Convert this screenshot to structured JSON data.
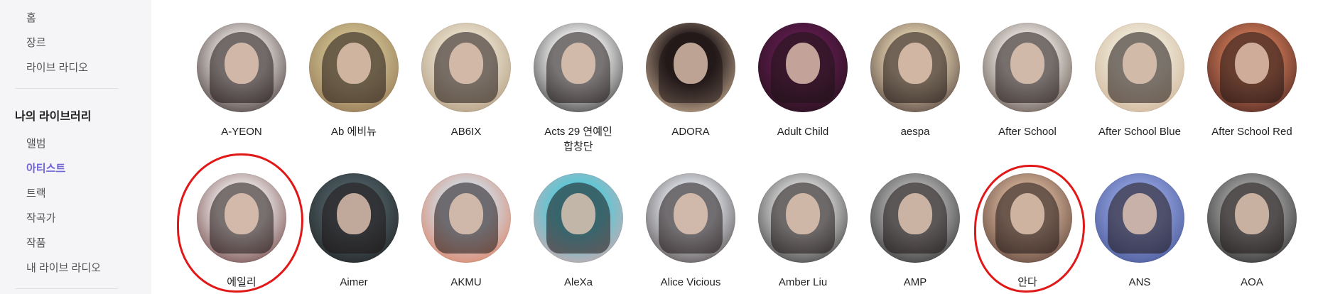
{
  "sidebar": {
    "nav_top": [
      {
        "label": "홈"
      },
      {
        "label": "장르"
      },
      {
        "label": "라이브 라디오"
      }
    ],
    "library_title": "나의 라이브러리",
    "library_items": [
      {
        "label": "앨범"
      },
      {
        "label": "아티스트",
        "active": true
      },
      {
        "label": "트랙"
      },
      {
        "label": "작곡가"
      },
      {
        "label": "작품"
      },
      {
        "label": "내 라이브 라디오"
      }
    ]
  },
  "artists": [
    {
      "name": "A-YEON",
      "colors": [
        "#d9d2cf",
        "#2a1d1d"
      ]
    },
    {
      "name": "Ab 에비뉴",
      "colors": [
        "#c9b98a",
        "#8a6a4a"
      ]
    },
    {
      "name": "AB6IX",
      "colors": [
        "#e6dcc8",
        "#a58d6f"
      ]
    },
    {
      "name": "Acts 29 연예인 합창단",
      "colors": [
        "#e9e9e9",
        "#1e1e1e"
      ]
    },
    {
      "name": "ADORA",
      "colors": [
        "#2a2020",
        "#e7c8a8"
      ]
    },
    {
      "name": "Adult Child",
      "colors": [
        "#5a1a4a",
        "#1a1010"
      ]
    },
    {
      "name": "aespa",
      "colors": [
        "#d8c6a6",
        "#3a2a2a"
      ]
    },
    {
      "name": "After School",
      "colors": [
        "#e2ddd8",
        "#4a3a32"
      ]
    },
    {
      "name": "After School Blue",
      "colors": [
        "#ece6d4",
        "#c9a88a"
      ]
    },
    {
      "name": "After School Red",
      "colors": [
        "#c07050",
        "#3a1a1a"
      ]
    },
    {
      "name": "에일리",
      "colors": [
        "#e6dede",
        "#5a2a2a"
      ]
    },
    {
      "name": "Aimer",
      "colors": [
        "#4a5a60",
        "#1a1a1a"
      ]
    },
    {
      "name": "AKMU",
      "colors": [
        "#cfd6de",
        "#e0704a"
      ]
    },
    {
      "name": "AleXa",
      "colors": [
        "#5ac8d8",
        "#e8a0a0"
      ]
    },
    {
      "name": "Alice Vicious",
      "colors": [
        "#d8dce2",
        "#3a3030"
      ]
    },
    {
      "name": "Amber Liu",
      "colors": [
        "#d0d0d0",
        "#202020"
      ]
    },
    {
      "name": "AMP",
      "colors": [
        "#a9a9a9",
        "#1e1e1e"
      ]
    },
    {
      "name": "안다",
      "colors": [
        "#c9a890",
        "#4a3028"
      ]
    },
    {
      "name": "ANS",
      "colors": [
        "#8a9ad8",
        "#3a4a8a"
      ]
    },
    {
      "name": "AOA",
      "colors": [
        "#9a9a9a",
        "#1a1a1a"
      ]
    }
  ]
}
